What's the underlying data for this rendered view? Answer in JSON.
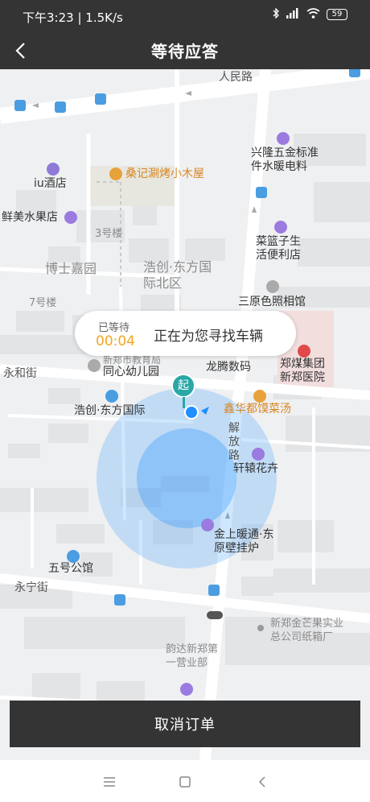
{
  "status_bar": {
    "time_speed": "下午3:23 | 1.5K/s",
    "battery": "59"
  },
  "header": {
    "title": "等待应答"
  },
  "map": {
    "pois": {
      "xinglong": "兴隆五金标准件水暖电料",
      "iu_hotel": "iu酒店",
      "sangji": "桑记涮烤小木屋",
      "xianmei": "鲜美水果店",
      "building3": "3号楼",
      "bosi": "博士嘉园",
      "haochuang_north": "浩创·东方国际北区",
      "cailanzi": "菜篮子生活便利店",
      "sanyuan": "三原色照相馆",
      "building7": "7号楼",
      "zhengmei": "郑煤集团新郑医院",
      "tongxin": "同心幼儿园",
      "xinzheng_edu": "新郑市教育局",
      "longteng": "龙腾数码",
      "xinhua": "鑫华都馍菜汤",
      "haochuang": "浩创·东方国际",
      "xuanyuan": "轩辕花卉",
      "jinshang": "金上暖通·东原壁挂炉",
      "wuhao": "五号公馆",
      "xinzheng_paper": "新郑金芒果实业总公司纸箱厂",
      "yunda": "韵达新郑第一营业部",
      "start_marker": "起"
    },
    "roads": {
      "renmin": "人民路",
      "yonghe": "永和街",
      "yongning": "永宁街",
      "jiefang": "解放路"
    }
  },
  "waiting": {
    "label": "已等待",
    "elapsed": "00:04",
    "message": "正在为您寻找车辆"
  },
  "cancel_label": "取消订单",
  "colors": {
    "bar": "#343434",
    "accent": "#f5a623",
    "radar": "#1e90ff"
  }
}
